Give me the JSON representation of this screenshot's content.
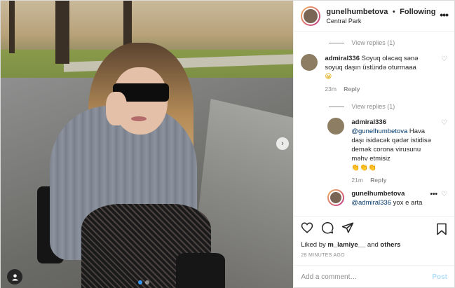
{
  "header": {
    "username": "gunelhumbetova",
    "separator": "•",
    "follow_status": "Following",
    "location": "Central Park",
    "more_icon": "•••"
  },
  "comments": {
    "view_replies_1": "View replies (1)",
    "c1": {
      "username": "admiral336",
      "text": "Soyuq olacaq sənə soyuq daşın üstündə oturmaaa",
      "emoji": "😀",
      "time": "23m",
      "reply": "Reply"
    },
    "view_replies_2": "View replies (1)",
    "c2": {
      "username": "admiral336",
      "mention": "@gunelhumbetova",
      "text": "Hava daşı isidəcək qədər istidisə demək corona virusunu məhv etmisiz",
      "emoji": "👏👏👏",
      "time": "21m",
      "reply": "Reply"
    },
    "c3": {
      "username": "gunelhumbetova",
      "mention": "@admiral336",
      "text": "yox e arta",
      "more_icon": "•••"
    }
  },
  "actions": {
    "likes_prefix": "Liked by",
    "liked_user": "m_lamiye__",
    "likes_mid": "and",
    "likes_others": "others",
    "timestamp": "28 MINUTES AGO"
  },
  "add_comment": {
    "placeholder": "Add a comment…",
    "post_label": "Post"
  },
  "colors": {
    "accent": "#3897f0",
    "link": "#00376b",
    "muted": "#8e8e8e",
    "post_disabled": "#b2dffc"
  },
  "carousel": {
    "total_slides": 2,
    "active_slide": 1
  }
}
